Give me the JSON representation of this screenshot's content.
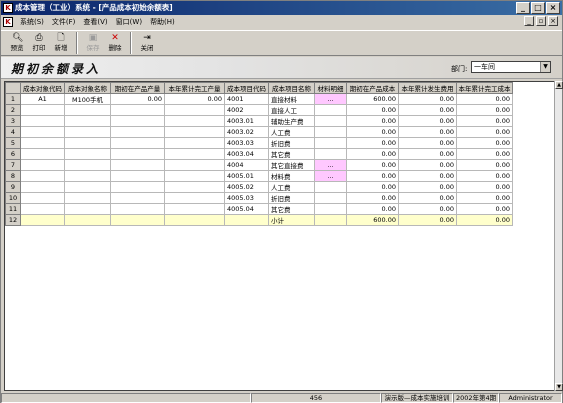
{
  "window": {
    "title": "成本管理（工业）系统 - [产品成本初始余额表]"
  },
  "menu": [
    "系统(S)",
    "文件(F)",
    "查看(V)",
    "窗口(W)",
    "帮助(H)"
  ],
  "toolbar": [
    {
      "label": "预览",
      "icon": "preview-icon"
    },
    {
      "label": "打印",
      "icon": "print-icon"
    },
    {
      "label": "新增",
      "icon": "new-icon"
    },
    {
      "label": "保存",
      "icon": "save-icon"
    },
    {
      "label": "删除",
      "icon": "delete-icon"
    },
    {
      "label": "关闭",
      "icon": "close-icon"
    }
  ],
  "header": {
    "title": "期初余额录入",
    "dept_label": "部门:",
    "dept_value": "一车间"
  },
  "table": {
    "columns": [
      "成本对象代码",
      "成本对象名称",
      "期初在产品产量",
      "本年累计完工产量",
      "成本项目代码",
      "成本项目名称",
      "材料明细",
      "期初在产品成本",
      "本年累计发生费用",
      "本年累计完工成本"
    ],
    "rows": [
      {
        "no": "1",
        "obj_code": "A1",
        "obj_name": "M100手机",
        "init_qty": "0.00",
        "done_qty": "0.00",
        "item_code": "4001",
        "item_name": "直接材料",
        "detail": "...",
        "init_cost": "600.00",
        "year_cost": "0.00",
        "done_cost": "0.00"
      },
      {
        "no": "2",
        "obj_code": "",
        "obj_name": "",
        "init_qty": "",
        "done_qty": "",
        "item_code": "4002",
        "item_name": "直接人工",
        "detail": "",
        "init_cost": "0.00",
        "year_cost": "0.00",
        "done_cost": "0.00"
      },
      {
        "no": "3",
        "obj_code": "",
        "obj_name": "",
        "init_qty": "",
        "done_qty": "",
        "item_code": "4003.01",
        "item_name": "辅助生产费",
        "detail": "",
        "init_cost": "0.00",
        "year_cost": "0.00",
        "done_cost": "0.00"
      },
      {
        "no": "4",
        "obj_code": "",
        "obj_name": "",
        "init_qty": "",
        "done_qty": "",
        "item_code": "4003.02",
        "item_name": "人工费",
        "detail": "",
        "init_cost": "0.00",
        "year_cost": "0.00",
        "done_cost": "0.00"
      },
      {
        "no": "5",
        "obj_code": "",
        "obj_name": "",
        "init_qty": "",
        "done_qty": "",
        "item_code": "4003.03",
        "item_name": "折旧费",
        "detail": "",
        "init_cost": "0.00",
        "year_cost": "0.00",
        "done_cost": "0.00"
      },
      {
        "no": "6",
        "obj_code": "",
        "obj_name": "",
        "init_qty": "",
        "done_qty": "",
        "item_code": "4003.04",
        "item_name": "其它费",
        "detail": "",
        "init_cost": "0.00",
        "year_cost": "0.00",
        "done_cost": "0.00"
      },
      {
        "no": "7",
        "obj_code": "",
        "obj_name": "",
        "init_qty": "",
        "done_qty": "",
        "item_code": "4004",
        "item_name": "其它直接费",
        "detail": "...",
        "init_cost": "0.00",
        "year_cost": "0.00",
        "done_cost": "0.00"
      },
      {
        "no": "8",
        "obj_code": "",
        "obj_name": "",
        "init_qty": "",
        "done_qty": "",
        "item_code": "4005.01",
        "item_name": "材料费",
        "detail": "...",
        "init_cost": "0.00",
        "year_cost": "0.00",
        "done_cost": "0.00"
      },
      {
        "no": "9",
        "obj_code": "",
        "obj_name": "",
        "init_qty": "",
        "done_qty": "",
        "item_code": "4005.02",
        "item_name": "人工费",
        "detail": "",
        "init_cost": "0.00",
        "year_cost": "0.00",
        "done_cost": "0.00"
      },
      {
        "no": "10",
        "obj_code": "",
        "obj_name": "",
        "init_qty": "",
        "done_qty": "",
        "item_code": "4005.03",
        "item_name": "折旧费",
        "detail": "",
        "init_cost": "0.00",
        "year_cost": "0.00",
        "done_cost": "0.00"
      },
      {
        "no": "11",
        "obj_code": "",
        "obj_name": "",
        "init_qty": "",
        "done_qty": "",
        "item_code": "4005.04",
        "item_name": "其它费",
        "detail": "",
        "init_cost": "0.00",
        "year_cost": "0.00",
        "done_cost": "0.00"
      },
      {
        "no": "12",
        "obj_code": "",
        "obj_name": "",
        "init_qty": "",
        "done_qty": "",
        "item_code": "",
        "item_name": "小计",
        "detail": "",
        "init_cost": "600.00",
        "year_cost": "0.00",
        "done_cost": "0.00"
      }
    ]
  },
  "status": [
    "",
    "456",
    "演示版—成本实施培训",
    "2002年第4期",
    "Administrator"
  ]
}
